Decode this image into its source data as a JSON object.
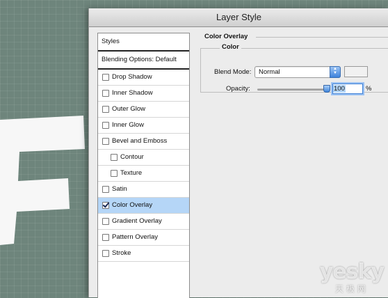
{
  "dialog": {
    "title": "Layer Style"
  },
  "canvas": {
    "letter_color": "#f7f7f7",
    "background_color": "#6e857c"
  },
  "left_panel": {
    "header": "Styles",
    "blending_options": "Blending Options: Default",
    "items": [
      {
        "label": "Drop Shadow",
        "checked": false,
        "indent": false
      },
      {
        "label": "Inner Shadow",
        "checked": false,
        "indent": false
      },
      {
        "label": "Outer Glow",
        "checked": false,
        "indent": false
      },
      {
        "label": "Inner Glow",
        "checked": false,
        "indent": false
      },
      {
        "label": "Bevel and Emboss",
        "checked": false,
        "indent": false
      },
      {
        "label": "Contour",
        "checked": false,
        "indent": true
      },
      {
        "label": "Texture",
        "checked": false,
        "indent": true
      },
      {
        "label": "Satin",
        "checked": false,
        "indent": false
      },
      {
        "label": "Color Overlay",
        "checked": true,
        "indent": false,
        "active": true
      },
      {
        "label": "Gradient Overlay",
        "checked": false,
        "indent": false
      },
      {
        "label": "Pattern Overlay",
        "checked": false,
        "indent": false
      },
      {
        "label": "Stroke",
        "checked": false,
        "indent": false
      }
    ]
  },
  "right_panel": {
    "section_title": "Color Overlay",
    "group_title": "Color",
    "blend_mode_label": "Blend Mode:",
    "blend_mode_value": "Normal",
    "overlay_color": "#f1f1f1",
    "opacity_label": "Opacity:",
    "opacity_value": "100",
    "opacity_unit": "%",
    "opacity_fraction": 1.0
  },
  "watermark": {
    "main": "yesky",
    "sub": "天极网"
  }
}
